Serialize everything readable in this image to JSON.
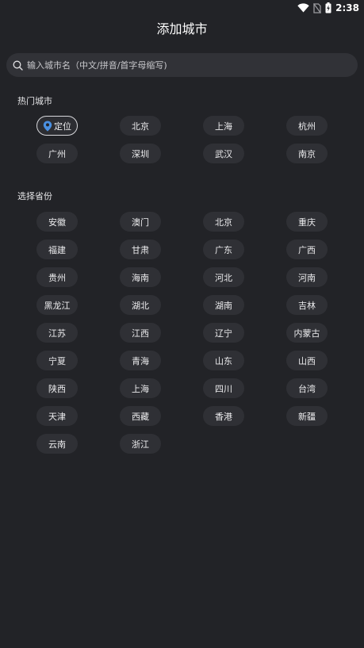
{
  "status_bar": {
    "time": "2:38",
    "icons": [
      "wifi-icon",
      "sim-no-signal-icon",
      "battery-charging-icon"
    ]
  },
  "header": {
    "title": "添加城市"
  },
  "search": {
    "placeholder": "输入城市名（中文/拼音/首字母缩写)",
    "value": "",
    "icon": "search-icon"
  },
  "hot_cities": {
    "title": "热门城市",
    "locate": {
      "label": "定位",
      "icon": "location-pin-icon",
      "icon_color": "#4a90e2"
    },
    "items": [
      "北京",
      "上海",
      "杭州",
      "广州",
      "深圳",
      "武汉",
      "南京"
    ]
  },
  "provinces": {
    "title": "选择省份",
    "items": [
      "安徽",
      "澳门",
      "北京",
      "重庆",
      "福建",
      "甘肃",
      "广东",
      "广西",
      "贵州",
      "海南",
      "河北",
      "河南",
      "黑龙江",
      "湖北",
      "湖南",
      "吉林",
      "江苏",
      "江西",
      "辽宁",
      "内蒙古",
      "宁夏",
      "青海",
      "山东",
      "山西",
      "陕西",
      "上海",
      "四川",
      "台湾",
      "天津",
      "西藏",
      "香港",
      "新疆",
      "云南",
      "浙江"
    ]
  }
}
